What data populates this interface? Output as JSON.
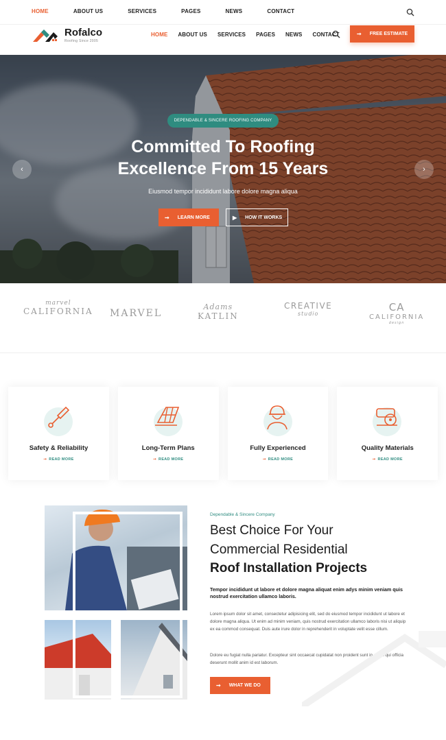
{
  "topbar": {
    "menu": [
      "HOME",
      "ABOUT US",
      "SERVICES",
      "PAGES",
      "NEWS",
      "CONTACT"
    ],
    "active": "HOME",
    "search_icon": "search-icon"
  },
  "header": {
    "logo_name": "Rofalco",
    "logo_tagline": "Roofing Since 2005",
    "menu": [
      "HOME",
      "ABOUT US",
      "SERVICES",
      "PAGES",
      "NEWS",
      "CONTACT"
    ],
    "cta": "FREE ESTIMATE"
  },
  "hero": {
    "badge": "DEPENDABLE & SINCERE ROOFING COMPANY",
    "title_line1": "Committed To Roofing",
    "title_line2": "Excellence From 15 Years",
    "subtitle": "Eiusmod tempor incididunt labore dolore magna aliqua",
    "btn_primary": "LEARN MORE",
    "btn_secondary": "HOW IT WORKS",
    "prev_icon": "chevron-left-icon",
    "next_icon": "chevron-right-icon"
  },
  "brands": [
    {
      "line1": "marvel",
      "line2": "CALIFORNIA",
      "line3": ""
    },
    {
      "line1": "",
      "line2": "MARVEL",
      "line3": ""
    },
    {
      "line1": "Adams",
      "line2": "KATLIN",
      "line3": ""
    },
    {
      "line1": "CREATIVE",
      "line2": "studio",
      "line3": ""
    },
    {
      "line1": "CA",
      "line2": "CALIFORNIA",
      "line3": "design"
    }
  ],
  "services": [
    {
      "title": "Safety & Reliability",
      "more": "READ MORE",
      "icon": "trowel-icon"
    },
    {
      "title": "Long-Term Plans",
      "more": "READ MORE",
      "icon": "solar-roof-icon"
    },
    {
      "title": "Fully Experienced",
      "more": "READ MORE",
      "icon": "worker-icon"
    },
    {
      "title": "Quality Materials",
      "more": "READ MORE",
      "icon": "saw-icon"
    }
  ],
  "about": {
    "kicker": "Dependable & Sincere Company",
    "title_line1": "Best Choice For Your",
    "title_line2": "Commercial Residential",
    "title_line3": "Roof Installation Projects",
    "lead": "Tempor incididunt ut labore et dolore magna aliquat enim adys minim veniam quis nostrud exercitation ullamco laboris.",
    "para1": "Lorem ipsum dolor sit amet, consectetur adipisicing elit, sed do eiusmod tempor incididunt ut labore et dolore magna aliqua. Ut enim ad minim veniam, quis nostrud exercitation ullamco laboris nisi ut aliquip ex ea commod consequat. Duis aute irure dolor in reprehenderit in voluptate velit esse cillum.",
    "para2": "Dolore eu fugiat nulla pariatur. Excepteur sint occaecat cupidatat non proident sunt in culpa qui officia deserunt mollit anim id est laborum.",
    "btn": "WHAT WE DO"
  },
  "colors": {
    "accent": "#e95f31",
    "teal": "#2f8c80"
  }
}
